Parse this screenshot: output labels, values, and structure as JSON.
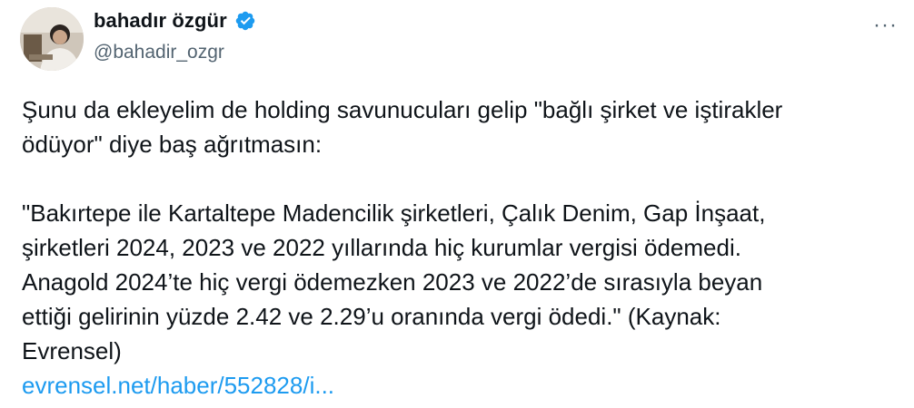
{
  "author": {
    "display_name": "bahadır özgür",
    "handle": "@bahadir_ozgr",
    "verified_icon": "verified-badge-icon",
    "verified_color": "#1d9bf0",
    "avatar_icon": "profile-photo"
  },
  "menu": {
    "more_icon": "more-horizontal-icon",
    "more_glyph": "···"
  },
  "tweet": {
    "paragraph1": "Şunu da ekleyelim de holding savunucuları gelip \"bağlı şirket ve iştirakler\nödüyor\" diye baş ağrıtmasın:",
    "paragraph2": "\"Bakırtepe ile Kartaltepe Madencilik şirketleri, Çalık Denim, Gap İnşaat,\nşirketleri 2024, 2023 ve 2022 yıllarında hiç kurumlar vergisi ödemedi.\nAnagold 2024’te hiç vergi ödemezken 2023 ve 2022’de sırasıyla beyan\nettiği gelirinin yüzde 2.42 ve 2.29’u oranında vergi ödedi.\" (Kaynak:\nEvrensel)",
    "link_text": "evrensel.net/haber/552828/i..."
  },
  "colors": {
    "text": "#0f1419",
    "secondary": "#536471",
    "link": "#1d9bf0"
  }
}
